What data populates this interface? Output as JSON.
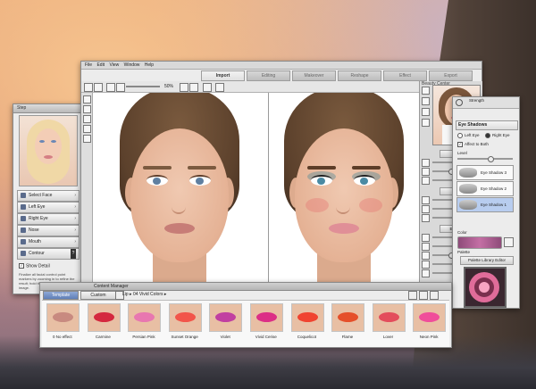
{
  "app": {
    "menu": [
      "File",
      "Edit",
      "View",
      "Window",
      "Help"
    ],
    "tabs": [
      "Import",
      "Editing",
      "Makeover",
      "Reshape",
      "Effect",
      "Export"
    ],
    "active_tab": "Import",
    "zoom": "50%"
  },
  "left_panel": {
    "title": "Step",
    "items": [
      "Select Face",
      "Left Eye",
      "Right Eye",
      "Nose",
      "Mouth",
      "Contour"
    ],
    "show_detail_label": "Show Detail",
    "detail_text": "Finalize all facial control point markers by zooming in to refine the result; hold the Shift key to pan the image."
  },
  "right_strip": {
    "title": "Beauty Center",
    "labels": [
      "Skin",
      "Makeup",
      "Eye Palette"
    ]
  },
  "eye_panel": {
    "strength_label": "Strength",
    "section_title": "Eye Shadows",
    "left_eye": "Left Eye",
    "right_eye": "Right Eye",
    "affect_both": "Affect to Both",
    "level_label": "Level",
    "layers": [
      "Eye Shadow 3",
      "Eye Shadow 2",
      "Eye Shadow 1"
    ],
    "color_label": "Color",
    "palette_label": "Palette",
    "palette_button": "Palette Library Editor"
  },
  "content_manager": {
    "title": "Content Manager",
    "tabs": [
      "Template",
      "Custom"
    ],
    "path": "Lip ▸ 04 Vivid Colors ▸",
    "items": [
      {
        "name": "0 No effect",
        "color": "#c88a80"
      },
      {
        "name": "Carmine",
        "color": "#d4283f"
      },
      {
        "name": "Persian Pink",
        "color": "#e877b0"
      },
      {
        "name": "Sunset Orange",
        "color": "#f2554a"
      },
      {
        "name": "Violet",
        "color": "#c13fa1"
      },
      {
        "name": "Vivid Cerise",
        "color": "#dc2f86"
      },
      {
        "name": "Coquelicot",
        "color": "#f04330"
      },
      {
        "name": "Flame",
        "color": "#e54f2a"
      },
      {
        "name": "Lover",
        "color": "#e34d5c"
      },
      {
        "name": "Neon Pink",
        "color": "#f04e9a"
      }
    ]
  }
}
